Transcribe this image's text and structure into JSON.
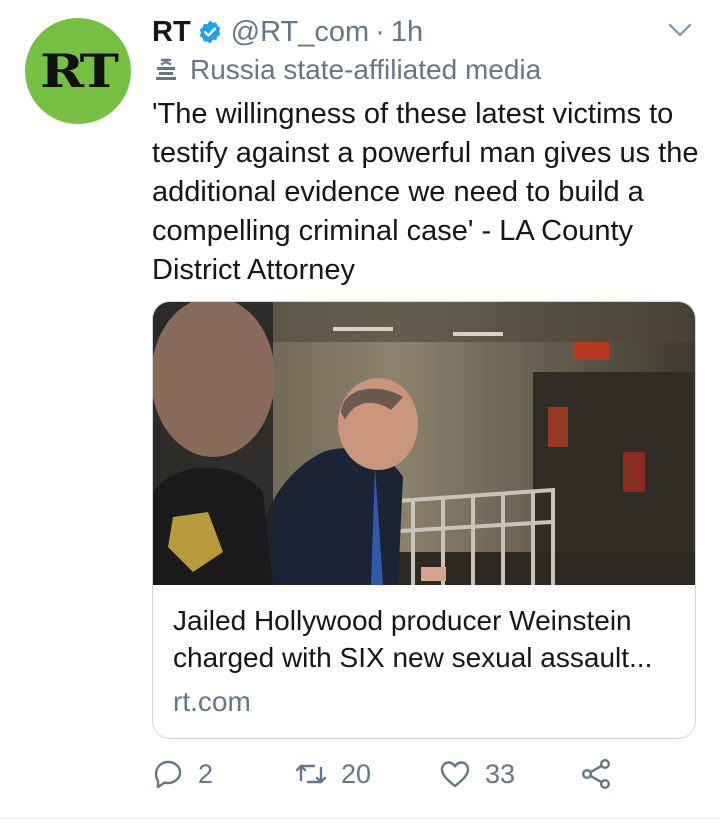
{
  "account": {
    "avatar_text": "RT",
    "name": "RT",
    "handle": "@RT_com",
    "separator": "·",
    "time": "1h",
    "affiliation": "Russia state-affiliated media"
  },
  "tweet": {
    "text": "'The willingness of these latest victims to testify against a powerful man gives us the additional evidence we need to build a compelling criminal case' - LA County District Attorney"
  },
  "card": {
    "title_line1": "Jailed Hollywood producer Weinstein",
    "title_line2": "charged with SIX new sexual assault...",
    "domain": "rt.com"
  },
  "actions": {
    "reply_count": "2",
    "retweet_count": "20",
    "like_count": "33"
  },
  "colors": {
    "avatar_bg": "#76c043",
    "verified": "#1da1f2",
    "secondary_text": "#657786",
    "border": "#ccd6dd"
  },
  "icons": [
    "verified-badge-icon",
    "chevron-down-icon",
    "flag-icon",
    "reply-icon",
    "retweet-icon",
    "like-icon",
    "share-icon"
  ]
}
